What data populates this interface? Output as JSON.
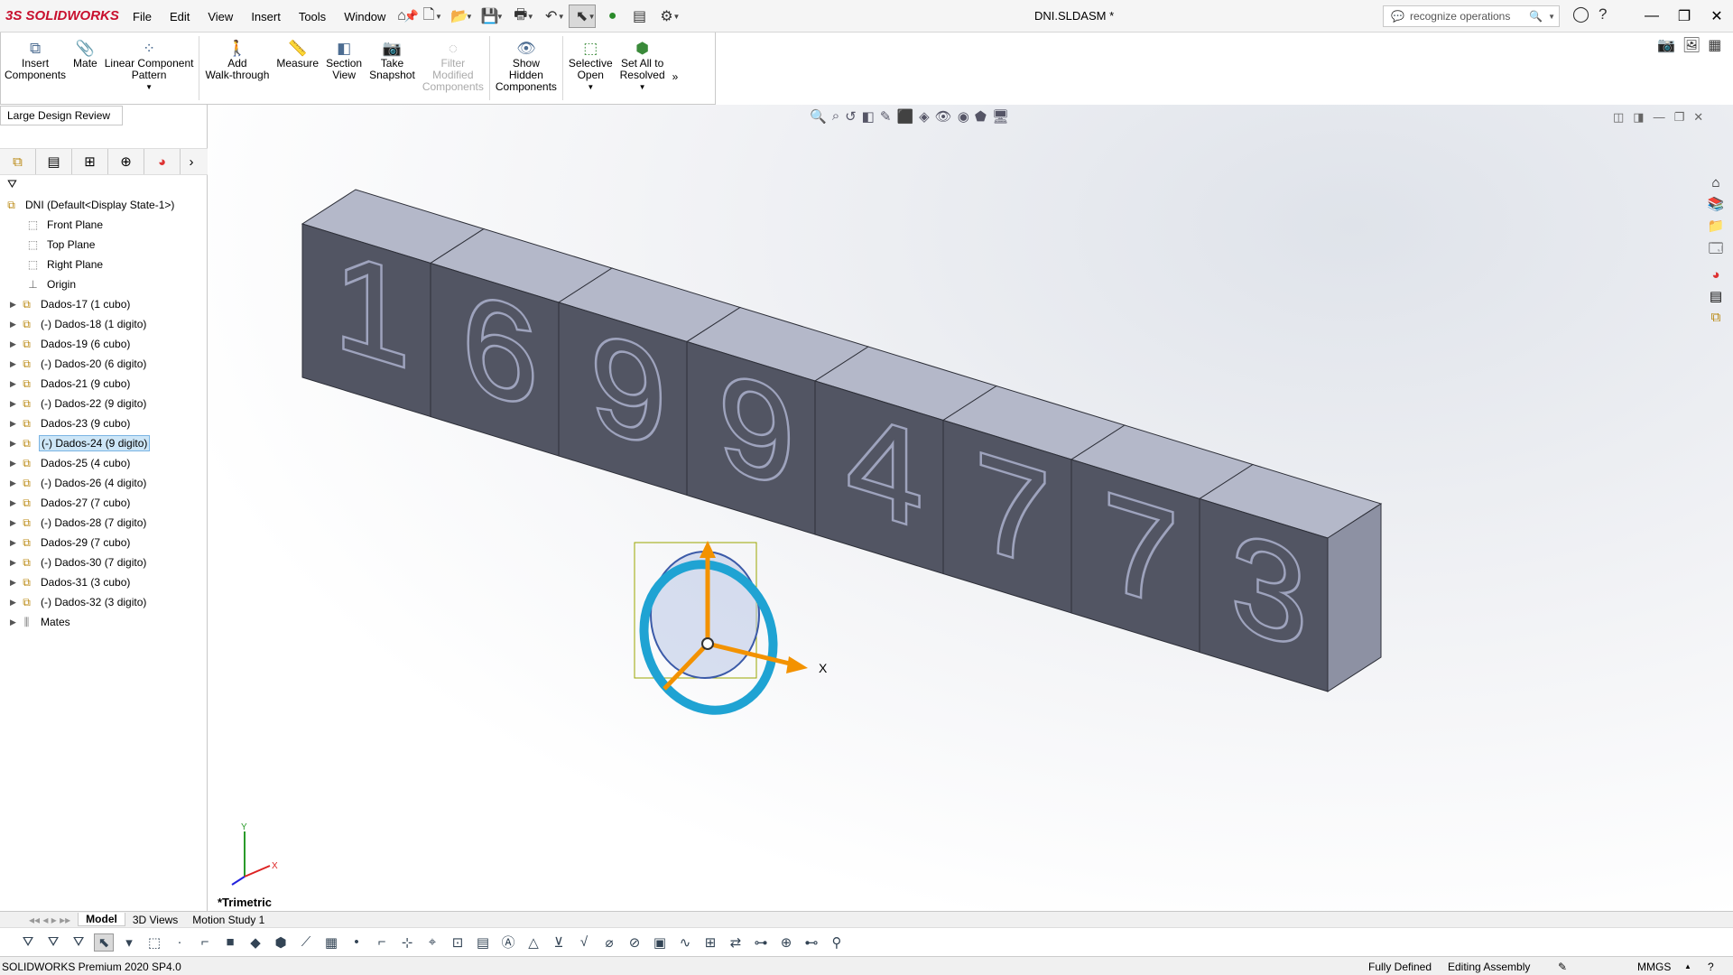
{
  "app": {
    "brand_prefix": "3S",
    "brand": "SOLIDWORKS",
    "doc_title": "DNI.SLDASM *"
  },
  "menu": [
    "File",
    "Edit",
    "View",
    "Insert",
    "Tools",
    "Window"
  ],
  "search": {
    "placeholder": "recognize operations"
  },
  "ribbon": {
    "insert_components": [
      "Insert",
      "Components"
    ],
    "mate": [
      "Mate"
    ],
    "linear_pattern": [
      "Linear Component",
      "Pattern"
    ],
    "walkthrough": [
      "Add",
      "Walk-through"
    ],
    "measure": [
      "Measure"
    ],
    "section_view": [
      "Section",
      "View"
    ],
    "snapshot": [
      "Take",
      "Snapshot"
    ],
    "filter_modified": [
      "Filter",
      "Modified",
      "Components"
    ],
    "show_hidden": [
      "Show",
      "Hidden",
      "Components"
    ],
    "selective_open": [
      "Selective",
      "Open"
    ],
    "set_resolved": [
      "Set All to",
      "Resolved"
    ]
  },
  "featuremanager": {
    "tab": "Large Design Review",
    "root": "DNI  (Default<Display State-1>)",
    "items": [
      {
        "label": "Front Plane",
        "type": "plane",
        "expand": false
      },
      {
        "label": "Top Plane",
        "type": "plane",
        "expand": false
      },
      {
        "label": "Right Plane",
        "type": "plane",
        "expand": false
      },
      {
        "label": "Origin",
        "type": "origin",
        "expand": false
      },
      {
        "label": "Dados-17 (1 cubo)",
        "type": "comp",
        "expand": true
      },
      {
        "label": "(-) Dados-18 (1 digito)",
        "type": "comp",
        "expand": true
      },
      {
        "label": "Dados-19 (6 cubo)",
        "type": "comp",
        "expand": true
      },
      {
        "label": "(-) Dados-20 (6 digito)",
        "type": "comp",
        "expand": true
      },
      {
        "label": "Dados-21 (9 cubo)",
        "type": "comp",
        "expand": true
      },
      {
        "label": "(-) Dados-22 (9 digito)",
        "type": "comp",
        "expand": true
      },
      {
        "label": "Dados-23 (9 cubo)",
        "type": "comp",
        "expand": true
      },
      {
        "label": "(-) Dados-24 (9 digito)",
        "type": "comp",
        "expand": true,
        "selected": true
      },
      {
        "label": "Dados-25 (4 cubo)",
        "type": "comp",
        "expand": true
      },
      {
        "label": "(-) Dados-26 (4 digito)",
        "type": "comp",
        "expand": true
      },
      {
        "label": "Dados-27 (7 cubo)",
        "type": "comp",
        "expand": true
      },
      {
        "label": "(-) Dados-28 (7 digito)",
        "type": "comp",
        "expand": true
      },
      {
        "label": "Dados-29 (7 cubo)",
        "type": "comp",
        "expand": true
      },
      {
        "label": "(-) Dados-30 (7 digito)",
        "type": "comp",
        "expand": true
      },
      {
        "label": "Dados-31 (3 cubo)",
        "type": "comp",
        "expand": true
      },
      {
        "label": "(-) Dados-32 (3 digito)",
        "type": "comp",
        "expand": true
      },
      {
        "label": "Mates",
        "type": "mates",
        "expand": true
      }
    ]
  },
  "viewport": {
    "view_label": "*Trimetric",
    "digits": [
      "1",
      "6",
      "9",
      "9",
      "4",
      "7",
      "7",
      "3"
    ],
    "triad_x": "X",
    "axis": {
      "x": "X",
      "y": "Y"
    }
  },
  "bottom_tabs": [
    "Model",
    "3D Views",
    "Motion Study 1"
  ],
  "status": {
    "version": "SOLIDWORKS Premium 2020 SP4.0",
    "defined": "Fully Defined",
    "mode": "Editing Assembly",
    "units": "MMGS"
  },
  "colors": {
    "cube_front": "#525563",
    "cube_top": "#b4b8c9",
    "cube_side": "#8d91a3",
    "triad": "#f39200",
    "ring": "#1fa3d3",
    "selection": "#cde6f7"
  }
}
